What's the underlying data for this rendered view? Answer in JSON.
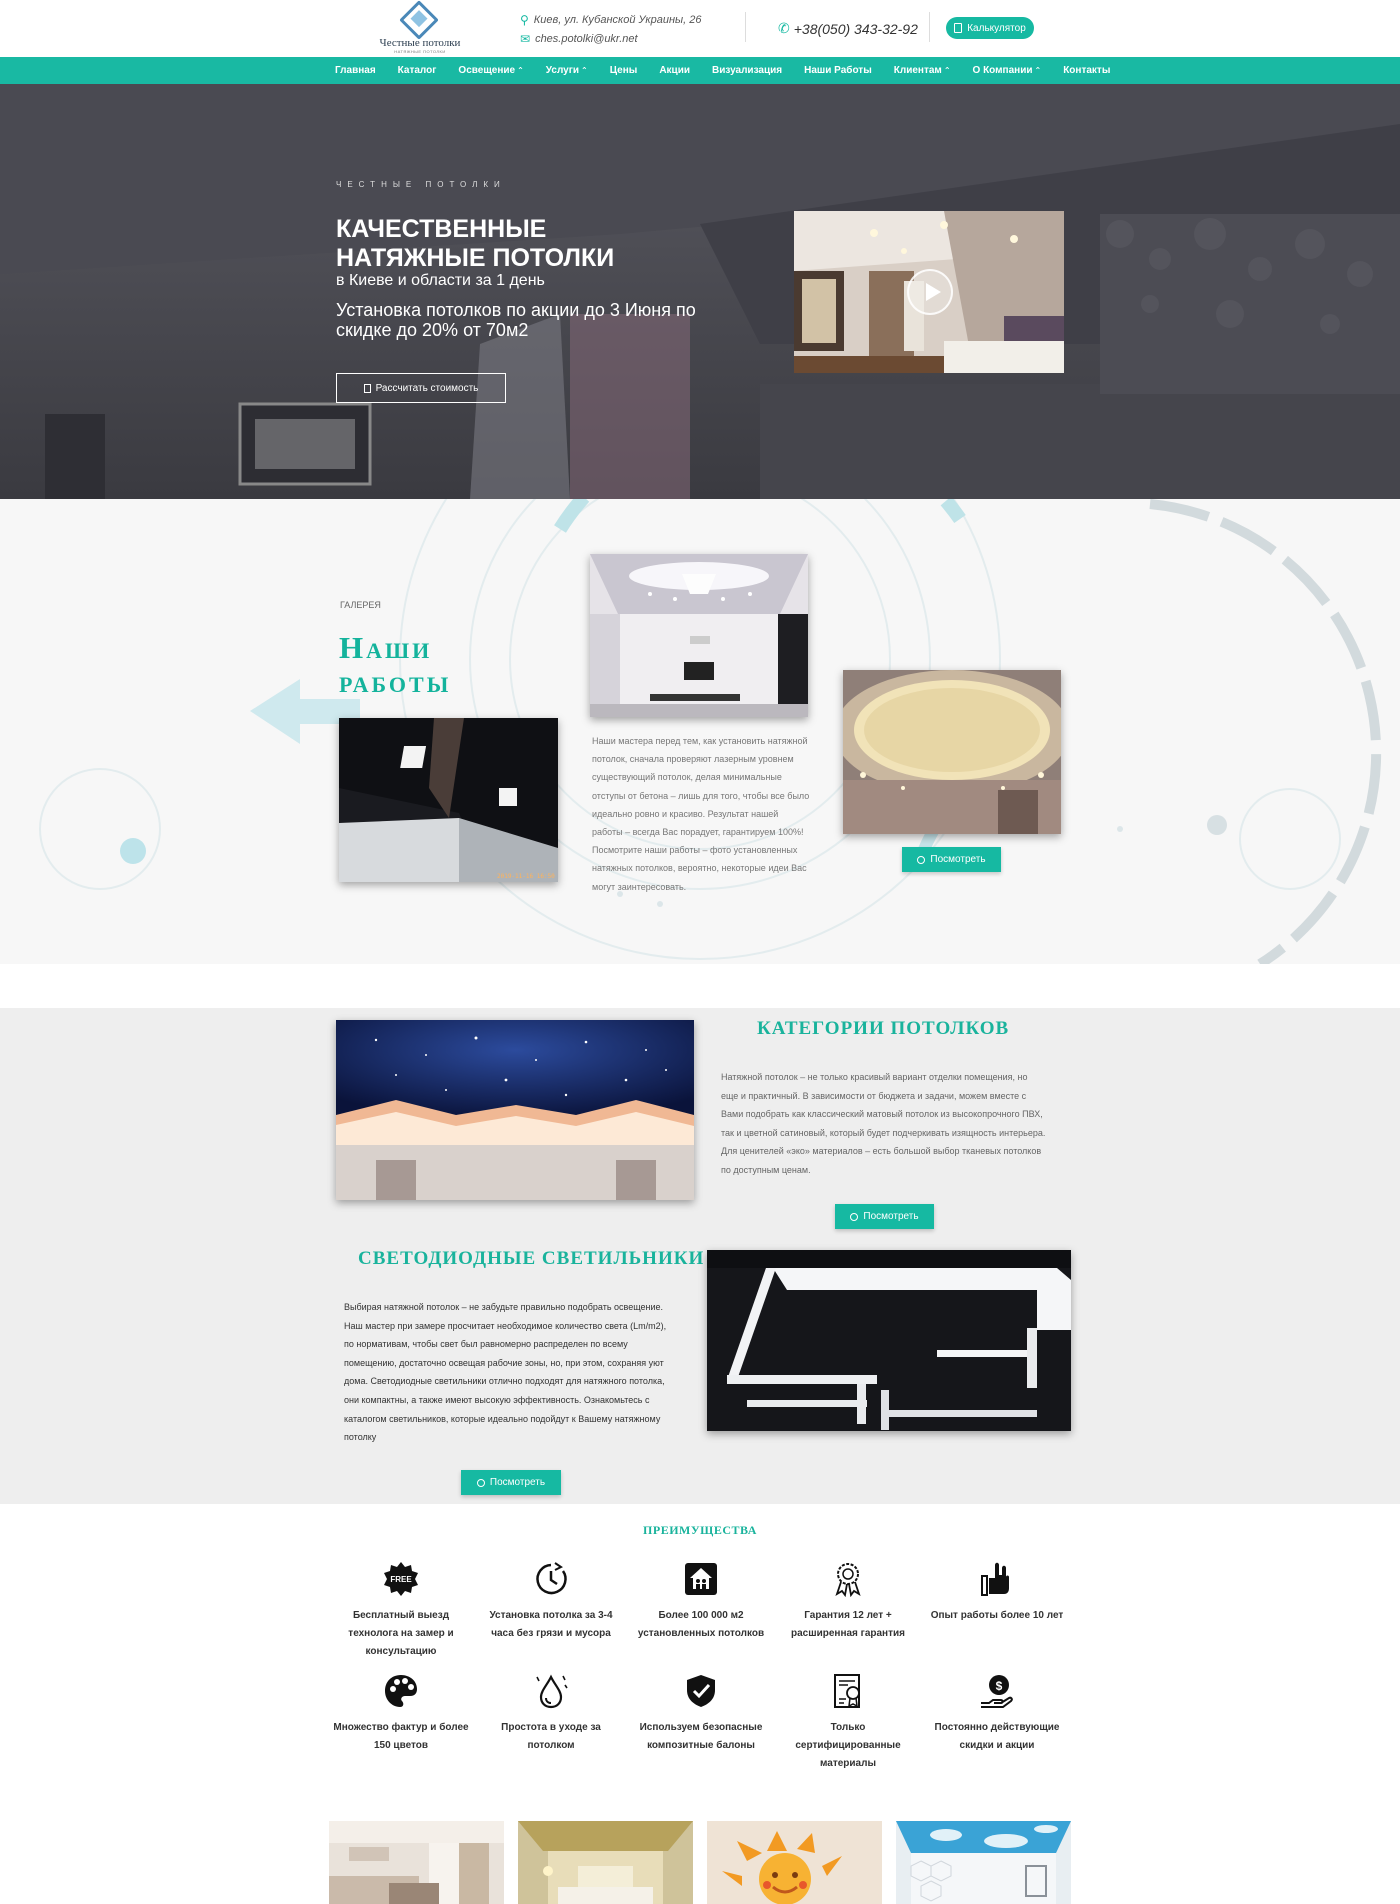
{
  "header": {
    "logo_name": "Честные потолки",
    "logo_sub": "НАТЯЖНЫЕ ПОТОЛКИ",
    "address": "Киев, ул. Кубанской Украины, 26",
    "email": "ches.potolki@ukr.net",
    "phone": "+38(050) 343-32-92",
    "calc_label": "Калькулятор"
  },
  "nav": {
    "items": [
      {
        "label": "Главная",
        "dropdown": false
      },
      {
        "label": "Каталог",
        "dropdown": false
      },
      {
        "label": "Освещение",
        "dropdown": true
      },
      {
        "label": "Услуги",
        "dropdown": true
      },
      {
        "label": "Цены",
        "dropdown": false
      },
      {
        "label": "Акции",
        "dropdown": false
      },
      {
        "label": "Визуализация",
        "dropdown": false
      },
      {
        "label": "Наши Работы",
        "dropdown": false
      },
      {
        "label": "Клиентам",
        "dropdown": true
      },
      {
        "label": "О Компании",
        "dropdown": true
      },
      {
        "label": "Контакты",
        "dropdown": false
      }
    ],
    "chevron": "⌃"
  },
  "hero": {
    "kicker": "ЧЕСТНЫЕ ПОТОЛКИ",
    "title_line1": "КАЧЕСТВЕННЫЕ",
    "title_line2": "НАТЯЖНЫЕ ПОТОЛКИ",
    "city": "в Киеве и области за 1 день",
    "promo": "Установка потолков по акции до 3 Июня по скидке до 20% от 70м2",
    "button": "Рассчитать стоимость"
  },
  "gallery": {
    "kicker": "ГАЛЕРЕЯ",
    "title_line1": "Наши",
    "title_line2": "работы",
    "photo_timestamp": "2019-11-16 16:50",
    "text": "Наши мастера перед тем, как установить натяжной потолок, сначала проверяют лазерным уровнем существующий потолок, делая минимальные отступы от бетона – лишь для того, чтобы все было идеально ровно и красиво. Результат нашей работы – всегда Вас порадует, гарантируем 100%! Посмотрите наши работы – фото установленных натяжных потолков, вероятно, некоторые идеи Вас могут заинтересовать.",
    "button": "Посмотреть"
  },
  "categories": {
    "title": "КАТЕГОРИИ ПОТОЛКОВ",
    "text": "Натяжной потолок – не только красивый вариант отделки помещения, но еще и практичный. В зависимости от бюджета и задачи, можем вместе с Вами подобрать как классический матовый потолок из высокопрочного ПВХ, так и цветной сатиновый, который будет подчеркивать изящность интерьера. Для ценителей «эко» материалов – есть большой выбор тканевых потолков по доступным ценам.",
    "button": "Посмотреть"
  },
  "led": {
    "title": "СВЕТОДИОДНЫЕ СВЕТИЛЬНИКИ",
    "text": "Выбирая натяжной потолок – не забудьте правильно подобрать освещение. Наш мастер при замере просчитает необходимое количество света (Lm/m2), по нормативам, чтобы свет был равномерно распределен по всему помещению, достаточно освещая рабочие зоны, но, при этом, сохраняя уют дома. Светодиодные светильники отлично подходят для натяжного потолка, они компактны, а также имеют высокую эффективность. Ознакомьтесь с каталогом светильников, которые идеально подойдут к Вашему натяжному потолку",
    "button": "Посмотреть"
  },
  "advantages": {
    "title": "ПРЕИМУЩЕСТВА",
    "free_badge": "FREE",
    "items": [
      {
        "label": "Бесплатный выезд технолога на замер и консультацию",
        "icon": "free-badge-icon"
      },
      {
        "label": "Установка потолка за 3-4 часа без грязи и мусора",
        "icon": "clock-icon"
      },
      {
        "label": "Более 100 000 м2 установленных потолков",
        "icon": "house-icon"
      },
      {
        "label": "Гарантия 12 лет + расширенная гарантия",
        "icon": "award-icon"
      },
      {
        "label": "Опыт работы более 10 лет",
        "icon": "hand-icon"
      },
      {
        "label": "Множество фактур и более 150 цветов",
        "icon": "palette-icon"
      },
      {
        "label": "Простота в уходе за потолком",
        "icon": "droplet-icon"
      },
      {
        "label": "Используем безопасные композитные балоны",
        "icon": "shield-icon"
      },
      {
        "label": "Только сертифицированные материалы",
        "icon": "certificate-icon"
      },
      {
        "label": "Постоянно действующие скидки и акции",
        "icon": "money-hand-icon"
      }
    ]
  },
  "colors": {
    "accent": "#19b9a3",
    "accent_text": "#14b39c"
  }
}
